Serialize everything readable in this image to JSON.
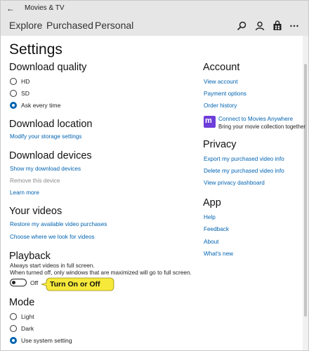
{
  "window": {
    "app_title": "Movies & TV"
  },
  "nav": {
    "tabs": [
      {
        "label": "Explore"
      },
      {
        "label": "Purchased"
      },
      {
        "label": "Personal"
      }
    ],
    "icons": [
      "search-icon",
      "account-icon",
      "store-icon",
      "more-icon"
    ]
  },
  "page": {
    "title": "Settings"
  },
  "download_quality": {
    "heading": "Download quality",
    "options": [
      {
        "label": "HD",
        "selected": false
      },
      {
        "label": "SD",
        "selected": false
      },
      {
        "label": "Ask every time",
        "selected": true
      }
    ]
  },
  "download_location": {
    "heading": "Download location",
    "link": "Modify your storage settings"
  },
  "download_devices": {
    "heading": "Download devices",
    "show_link": "Show my download devices",
    "remove_text": "Remove this device",
    "learn_link": "Learn more"
  },
  "your_videos": {
    "heading": "Your videos",
    "restore_link": "Restore my available video purchases",
    "choose_link": "Choose where we look for videos"
  },
  "playback": {
    "heading": "Playback",
    "line1": "Always start videos in full screen.",
    "line2": "When turned off, only windows that are maximized will go to full screen.",
    "toggle_state": "Off",
    "toggle_on": false
  },
  "callout": {
    "text": "Turn On or Off",
    "color": "#f6e93a"
  },
  "mode": {
    "heading": "Mode",
    "options": [
      {
        "label": "Light",
        "selected": false
      },
      {
        "label": "Dark",
        "selected": false
      },
      {
        "label": "Use system setting",
        "selected": true
      }
    ]
  },
  "account": {
    "heading": "Account",
    "links": [
      "View account",
      "Payment options",
      "Order history"
    ],
    "anywhere_title": "Connect to Movies Anywhere",
    "anywhere_sub": "Bring your movie collection together"
  },
  "privacy": {
    "heading": "Privacy",
    "links": [
      "Export my purchased video info",
      "Delete my purchased video info",
      "View privacy dashboard"
    ]
  },
  "app": {
    "heading": "App",
    "links": [
      "Help",
      "Feedback",
      "About",
      "What's new"
    ]
  },
  "colors": {
    "accent": "#0063b1",
    "titlebar": "#e6e6e6"
  }
}
